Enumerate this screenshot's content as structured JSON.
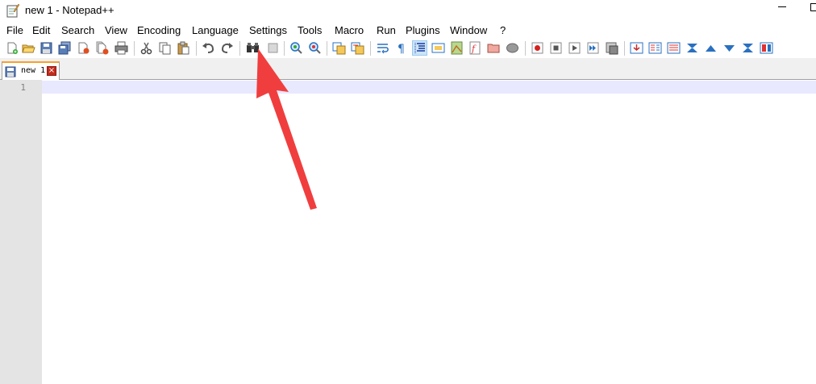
{
  "window": {
    "title": "new 1 - Notepad++"
  },
  "menu": {
    "items": [
      "File",
      "Edit",
      "Search",
      "View",
      "Encoding",
      "Language",
      "Settings",
      "Tools",
      "Macro",
      "Run",
      "Plugins",
      "Window",
      "?"
    ]
  },
  "tabs": [
    {
      "label": "new 1",
      "active": true
    }
  ],
  "editor": {
    "line_numbers": [
      "1"
    ],
    "content": ""
  },
  "annotation": {
    "type": "arrow",
    "color": "#f03e3e",
    "points_to": "Settings"
  }
}
